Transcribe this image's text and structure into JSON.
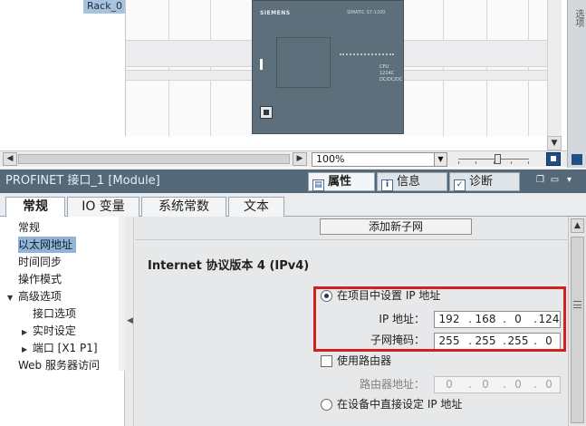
{
  "device_view": {
    "rack_label": "Rack_0",
    "plc": {
      "brand": "SIEMENS",
      "model": "SIMATIC S7-1200",
      "cpu_line1": "CPU 1214C",
      "cpu_line2": "DC/DC/DC"
    },
    "side_panel_label": "选项",
    "zoom": "100%",
    "zoom_level_percent": 100
  },
  "inspector": {
    "module_title": "PROFINET 接口_1 [Module]",
    "tabs": [
      {
        "label": "属性",
        "active": true,
        "icon": "properties-icon"
      },
      {
        "label": "信息",
        "active": false,
        "icon": "info-icon"
      },
      {
        "label": "诊断",
        "active": false,
        "icon": "diagnostics-icon"
      }
    ]
  },
  "subtabs": [
    {
      "label": "常规",
      "active": true
    },
    {
      "label": "IO 变量",
      "active": false
    },
    {
      "label": "系统常数",
      "active": false
    },
    {
      "label": "文本",
      "active": false
    }
  ],
  "nav": {
    "items": [
      {
        "label": "常规",
        "level": 0
      },
      {
        "label": "以太网地址",
        "level": 0,
        "selected": true
      },
      {
        "label": "时间同步",
        "level": 0
      },
      {
        "label": "操作模式",
        "level": 0
      },
      {
        "label": "高级选项",
        "level": 0,
        "expanded": true
      },
      {
        "label": "接口选项",
        "level": 1
      },
      {
        "label": "实时设定",
        "level": 1
      },
      {
        "label": "端口 [X1 P1]",
        "level": 1
      },
      {
        "label": "Web 服务器访问",
        "level": 0
      }
    ]
  },
  "content": {
    "add_subnet_button": "添加新子网",
    "section_title": "Internet 协议版本 4 (IPv4)",
    "options": {
      "set_in_project": "在项目中设置 IP 地址",
      "use_router": "使用路由器",
      "set_on_device": "在设备中直接设定 IP 地址"
    },
    "ip_label": "IP 地址：",
    "mask_label": "子网掩码：",
    "router_label": "路由器地址：",
    "ip_address": [
      "192",
      "168",
      "0",
      "124"
    ],
    "subnet_mask": [
      "255",
      "255",
      "255",
      "0"
    ],
    "router_address": [
      "0",
      "0",
      "0",
      "0"
    ]
  },
  "colors": {
    "header_bg": "#546877",
    "selected_nav": "#93b4d6",
    "highlight_border": "#d21f1f"
  }
}
